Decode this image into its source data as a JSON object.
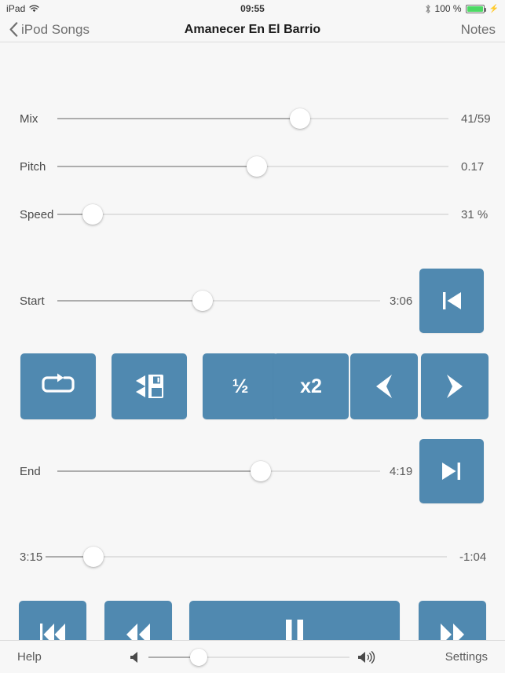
{
  "status_bar": {
    "device": "iPad",
    "wifi_icon": "wifi-icon",
    "time": "09:55",
    "bluetooth_icon": "bluetooth-icon",
    "battery_percent": "100 %",
    "battery_level": 100,
    "charging": true
  },
  "nav_bar": {
    "back_icon": "chevron-left-icon",
    "back_label": "iPod Songs",
    "title": "Amanecer En El Barrio",
    "right_label": "Notes"
  },
  "sliders": {
    "mix": {
      "label": "Mix",
      "value": "41/59",
      "percent": 62
    },
    "pitch": {
      "label": "Pitch",
      "value": "0.17",
      "percent": 51
    },
    "speed": {
      "label": "Speed",
      "value": "31 %",
      "percent": 9
    },
    "start": {
      "label": "Start",
      "value": "3:06",
      "percent": 45
    },
    "end": {
      "label": "End",
      "value": "4:19",
      "percent": 63
    },
    "position": {
      "left_value": "3:15",
      "right_value": "-1:04",
      "percent": 12
    }
  },
  "jump_buttons": {
    "start_icon": "skip-to-start-icon",
    "end_icon": "skip-to-end-icon"
  },
  "tool_row": [
    {
      "name": "loop-button",
      "icon": "loop-icon",
      "label": ""
    },
    {
      "name": "save-button",
      "icon": "save-floppy-icon",
      "label": ""
    },
    {
      "name": "half-speed-button",
      "icon": "",
      "label": "½"
    },
    {
      "name": "double-speed-button",
      "icon": "",
      "label": "x2"
    },
    {
      "name": "nudge-back-button",
      "icon": "chevron-left-icon",
      "label": ""
    },
    {
      "name": "nudge-forward-button",
      "icon": "chevron-right-icon",
      "label": ""
    }
  ],
  "transport": [
    {
      "name": "previous-track-button",
      "icon": "previous-track-icon"
    },
    {
      "name": "rewind-button",
      "icon": "rewind-icon"
    },
    {
      "name": "pause-button",
      "icon": "pause-icon"
    },
    {
      "name": "fast-forward-button",
      "icon": "fast-forward-icon"
    }
  ],
  "toolbar": {
    "help_label": "Help",
    "settings_label": "Settings",
    "volume_low_icon": "speaker-low-icon",
    "volume_high_icon": "speaker-high-icon",
    "volume_percent": 25
  },
  "colors": {
    "accent_blue": "#5089b0",
    "background": "#f7f7f7",
    "battery_green": "#4cd964",
    "track_active": "#636363",
    "track_inactive": "#c9c9c9"
  }
}
